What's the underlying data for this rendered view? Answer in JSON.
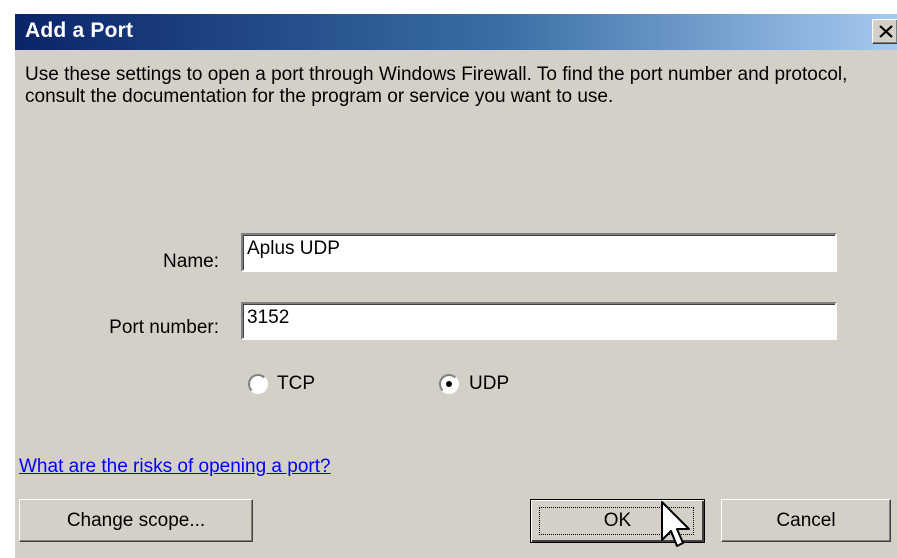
{
  "dialog": {
    "title": "Add a Port",
    "description": "Use these settings to open a port through Windows Firewall. To find the port number and protocol, consult the documentation for the program or service you want to use."
  },
  "form": {
    "name_label": "Name:",
    "name_value": "Aplus UDP",
    "port_label": "Port number:",
    "port_value": "3152",
    "protocol_options": [
      {
        "label": "TCP",
        "selected": false
      },
      {
        "label": "UDP",
        "selected": true
      }
    ]
  },
  "link": {
    "risks_text": "What are the risks of opening a port?"
  },
  "buttons": {
    "change_scope": "Change scope...",
    "ok": "OK",
    "cancel": "Cancel"
  },
  "icons": {
    "close": "close-icon",
    "cursor": "mouse-pointer-icon"
  },
  "colors": {
    "titlebar_start": "#0a246a",
    "titlebar_end": "#a6caf0",
    "dialog_bg": "#d4d0c8",
    "link": "#0000ff"
  }
}
